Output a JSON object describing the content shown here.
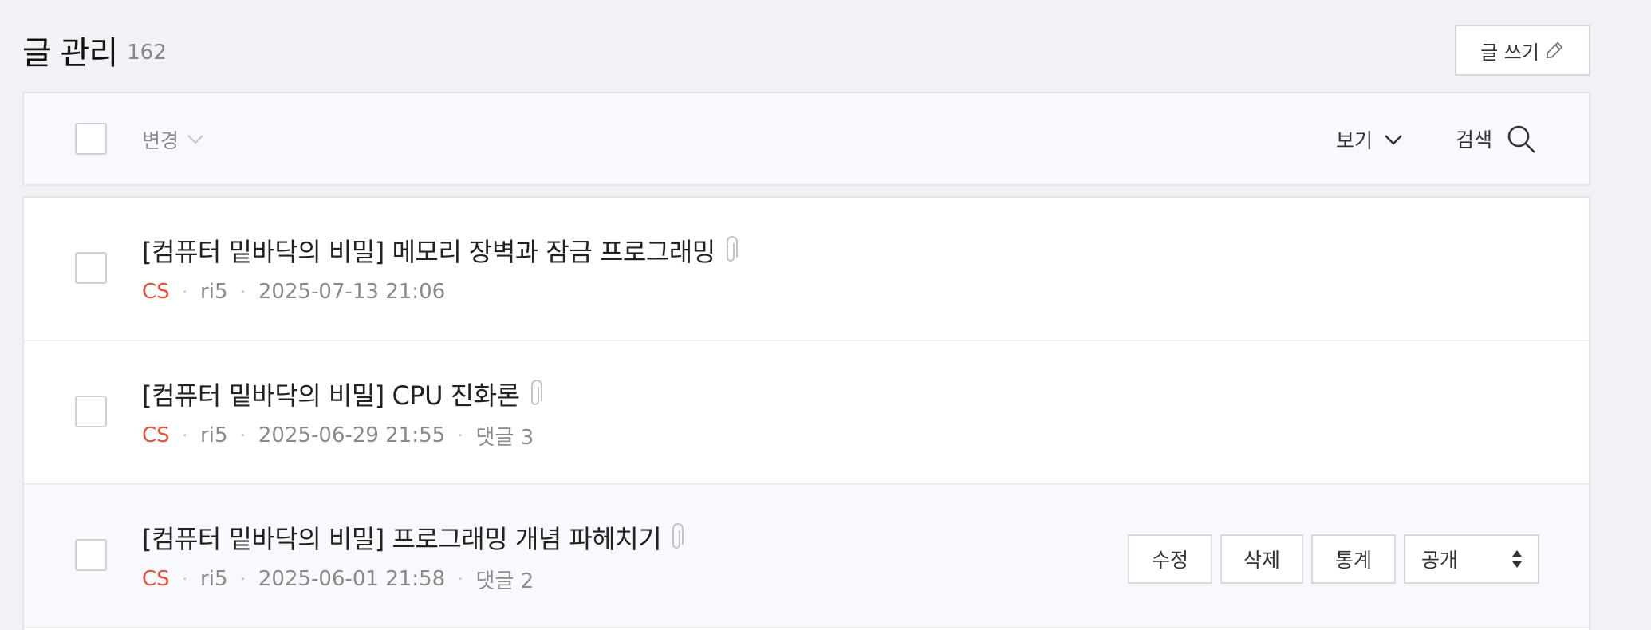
{
  "page": {
    "title": "글 관리",
    "count": "162"
  },
  "write_button": {
    "label": "글 쓰기",
    "icon": "pencil-icon"
  },
  "toolbar": {
    "change_label": "변경",
    "view_label": "보기",
    "search_label": "검색"
  },
  "posts": [
    {
      "title": "[컴퓨터 밑바닥의 비밀] 메모리 장벽과 잠금 프로그래밍",
      "category": "CS",
      "author": "ri5",
      "date": "2025-07-13 21:06",
      "comments": "",
      "has_attachment": true
    },
    {
      "title": "[컴퓨터 밑바닥의 비밀] CPU 진화론",
      "category": "CS",
      "author": "ri5",
      "date": "2025-06-29 21:55",
      "comments": "댓글 3",
      "has_attachment": true
    },
    {
      "title": "[컴퓨터 밑바닥의 비밀] 프로그래밍 개념 파헤치기",
      "category": "CS",
      "author": "ri5",
      "date": "2025-06-01 21:58",
      "comments": "댓글 2",
      "has_attachment": true
    }
  ],
  "row_actions": {
    "edit_label": "수정",
    "delete_label": "삭제",
    "stats_label": "통계",
    "visibility_value": "공개"
  },
  "colors": {
    "background": "#f1f2f5",
    "category": "#e5523b",
    "border": "#d6d8dd",
    "meta_text": "#8a8a8a"
  }
}
